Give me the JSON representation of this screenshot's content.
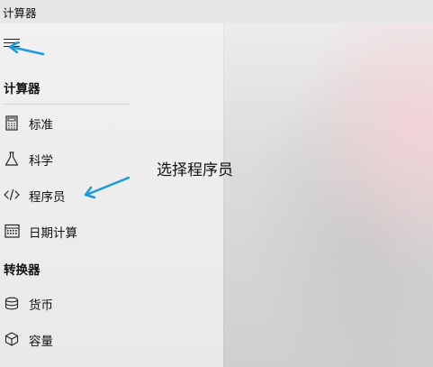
{
  "window": {
    "title": "计算器"
  },
  "nav": {
    "sections": [
      {
        "header": "计算器",
        "items": [
          {
            "label": "标准",
            "icon": "calculator-icon"
          },
          {
            "label": "科学",
            "icon": "flask-icon"
          },
          {
            "label": "程序员",
            "icon": "code-icon"
          },
          {
            "label": "日期计算",
            "icon": "calendar-icon"
          }
        ]
      },
      {
        "header": "转换器",
        "items": [
          {
            "label": "货币",
            "icon": "currency-icon"
          },
          {
            "label": "容量",
            "icon": "cube-icon"
          }
        ]
      }
    ]
  },
  "annotation": {
    "text": "选择程序员",
    "arrow_color": "#1a9be0"
  }
}
